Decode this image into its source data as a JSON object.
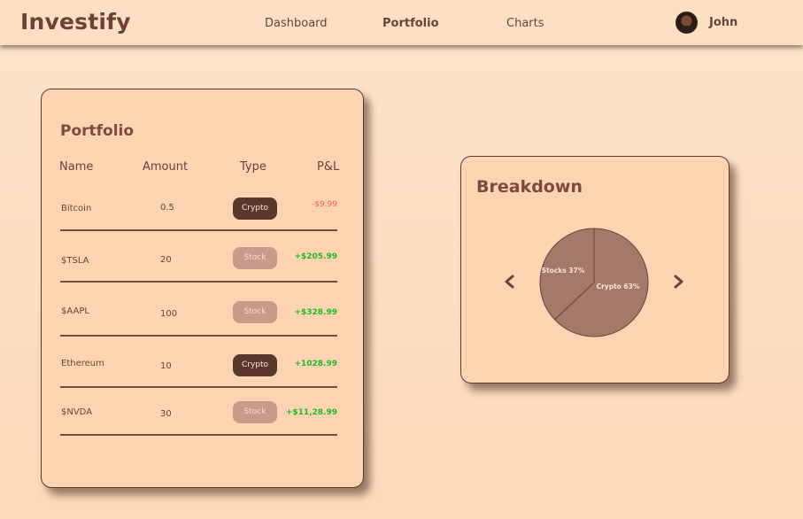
{
  "app": {
    "brand": "Investify"
  },
  "nav": {
    "links": [
      {
        "label": "Dashboard",
        "active": false
      },
      {
        "label": "Portfolio",
        "active": true
      },
      {
        "label": "Charts",
        "active": false
      }
    ],
    "user": {
      "name": "John",
      "avatar_icon": "user-avatar"
    }
  },
  "portfolio": {
    "title": "Portfolio",
    "columns": [
      "Name",
      "Amount",
      "Type",
      "P&L"
    ],
    "rows": [
      {
        "name": "Bitcoin",
        "amount": "0.5",
        "type": "Crypto",
        "pnl": "-$9.99",
        "pnl_sign": "neg"
      },
      {
        "name": "$TSLA",
        "amount": "20",
        "type": "Stock",
        "pnl": "+$205.99",
        "pnl_sign": "pos"
      },
      {
        "name": "$AAPL",
        "amount": "100",
        "type": "Stock",
        "pnl": "+$328.99",
        "pnl_sign": "pos"
      },
      {
        "name": "Ethereum",
        "amount": "10",
        "type": "Crypto",
        "pnl": "+1028.99",
        "pnl_sign": "pos"
      },
      {
        "name": "$NVDA",
        "amount": "30",
        "type": "Stock",
        "pnl": "+$11,28.99",
        "pnl_sign": "pos"
      }
    ]
  },
  "breakdown": {
    "title": "Breakdown",
    "prev_icon": "chevron-left-icon",
    "next_icon": "chevron-right-icon"
  },
  "chart_data": {
    "type": "pie",
    "categories": [
      "Stocks",
      "Crypto"
    ],
    "values": [
      37,
      63
    ],
    "labels": [
      "Stocks 37%",
      "Crypto 63%"
    ],
    "colors": [
      "#a4796a",
      "#a4796a"
    ]
  },
  "colors": {
    "accent": "#6b4336",
    "card": "#fdd4b1",
    "crypto_badge": "#5a362d",
    "stock_badge": "#c9998a",
    "negative": "#ff5a5a",
    "positive": "#22b92a"
  }
}
